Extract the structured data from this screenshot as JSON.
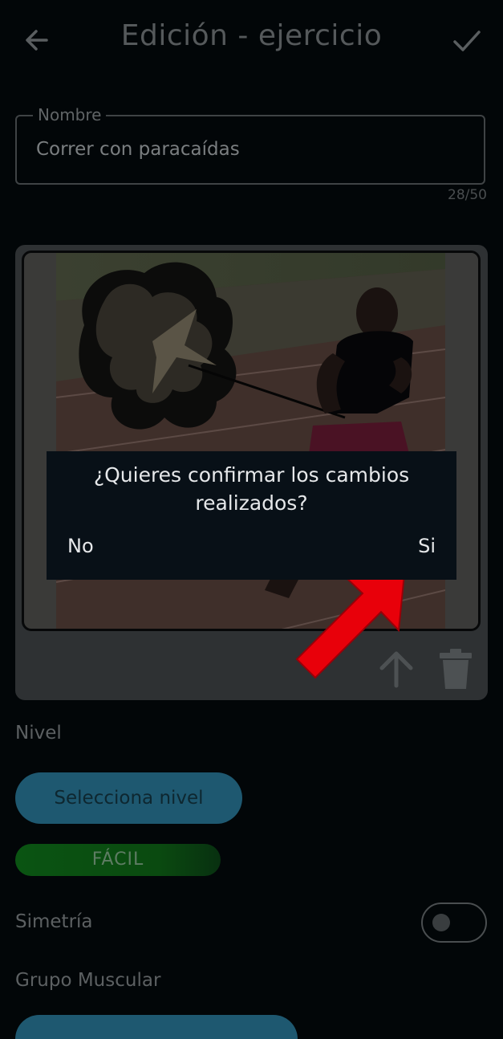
{
  "header": {
    "title": "Edición - ejercicio",
    "back_icon": "arrow-left-icon",
    "confirm_icon": "check-icon"
  },
  "name_field": {
    "label": "Nombre",
    "value": "Correr con paracaídas",
    "counter": "28/50"
  },
  "image_card": {
    "upload_icon": "arrow-up-icon",
    "delete_icon": "trash-icon"
  },
  "dialog": {
    "message": "¿Quieres confirmar los cambios realizados?",
    "no_label": "No",
    "yes_label": "Si"
  },
  "level": {
    "label": "Nivel",
    "select_button": "Selecciona nivel",
    "selected_badge": "FÁCIL"
  },
  "symmetry": {
    "label": "Simetría",
    "enabled": false
  },
  "muscle_group": {
    "label": "Grupo Muscular"
  },
  "colors": {
    "background": "#020608",
    "dialog_bg": "#081017",
    "primary_button": "#1e5870",
    "easy_badge": "#0a5412",
    "annotation_arrow": "#e8000a"
  }
}
